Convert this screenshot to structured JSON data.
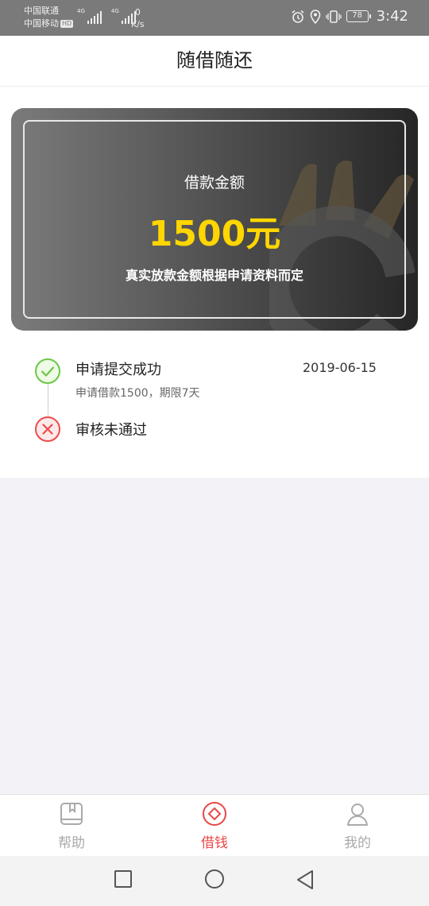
{
  "status_bar": {
    "carrier1": "中国联通",
    "carrier2": "中国移动",
    "hd_badge": "HD",
    "net1": "4G",
    "net2": "4G",
    "speed_value": "0",
    "speed_unit": "K/s",
    "battery": "78",
    "time": "3:42",
    "icons": [
      "alarm-icon",
      "location-icon",
      "vibrate-icon",
      "battery-icon"
    ]
  },
  "header": {
    "title": "随借随还"
  },
  "card": {
    "label": "借款金额",
    "amount": "1500元",
    "note": "真实放款金额根据申请资料而定",
    "amount_color": "#ffd600"
  },
  "timeline": [
    {
      "status": "success",
      "title": "申请提交成功",
      "date": "2019-06-15",
      "detail": "申请借款1500，期限7天",
      "icon": "check-circle-icon"
    },
    {
      "status": "failed",
      "title": "审核未通过",
      "icon": "x-circle-icon"
    }
  ],
  "tabbar": {
    "active_color": "#e94848",
    "items": [
      {
        "label": "帮助",
        "icon": "bookmark-book-icon",
        "active": false
      },
      {
        "label": "借钱",
        "icon": "diamond-circle-icon",
        "active": true
      },
      {
        "label": "我的",
        "icon": "user-icon",
        "active": false
      }
    ]
  },
  "system_nav": [
    "recent-apps-icon",
    "home-icon",
    "back-icon"
  ]
}
